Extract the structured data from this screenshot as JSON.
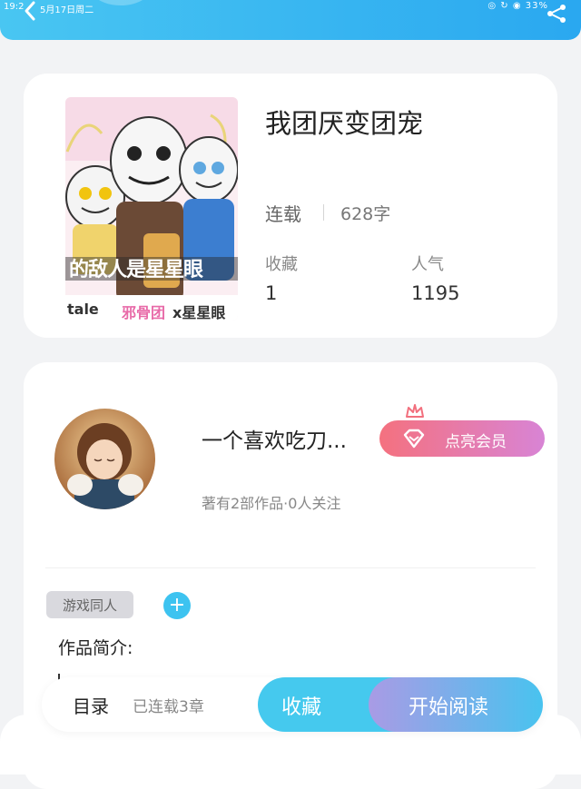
{
  "status_bar": {
    "time": "19:2",
    "date": "5月17日周二",
    "indicators": "◎ ↻ ◉ 33%"
  },
  "book": {
    "title": "我团厌变团宠",
    "status": "连载",
    "word_count": "628字",
    "favorites_label": "收藏",
    "favorites_value": "1",
    "popularity_label": "人气",
    "popularity_value": "1195"
  },
  "cover": {
    "overlay_text": "的敌人是星星眼",
    "bottom_left": "tale",
    "bottom_pink": "邪骨团",
    "bottom_dark": "x星星眼"
  },
  "author": {
    "name": "一个喜欢吃刀...",
    "stats": "著有2部作品·0人关注",
    "vip_button": "点亮会员"
  },
  "tags": [
    "游戏同人"
  ],
  "add_tag_symbol": "+",
  "intro_label": "作品简介:",
  "bottom_bar": {
    "toc": "目录",
    "chapters": "已连载3章",
    "collect": "收藏",
    "read": "开始阅读"
  },
  "colors": {
    "accent_blue": "#45c9ee",
    "vip_pink": "#f4717f",
    "vip_purple": "#d884d5",
    "read_purple": "#a99be5"
  },
  "icons": [
    "back-arrow-icon",
    "share-icon",
    "diamond-icon",
    "crown-icon",
    "plus-icon"
  ]
}
